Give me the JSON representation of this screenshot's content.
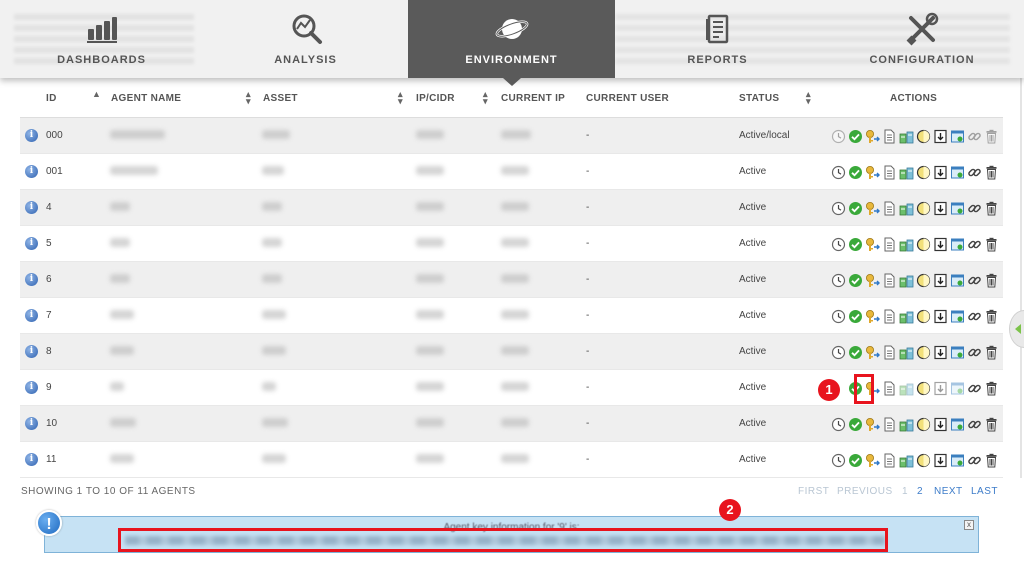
{
  "nav": {
    "tabs": [
      {
        "label": "DASHBOARDS",
        "icon": "bar-chart-icon"
      },
      {
        "label": "ANALYSIS",
        "icon": "magnify-chart-icon"
      },
      {
        "label": "ENVIRONMENT",
        "icon": "planet-icon",
        "active": true
      },
      {
        "label": "REPORTS",
        "icon": "document-icon"
      },
      {
        "label": "CONFIGURATION",
        "icon": "tools-icon"
      }
    ]
  },
  "table": {
    "headers": [
      "ID",
      "AGENT NAME",
      "ASSET",
      "IP/CIDR",
      "CURRENT IP",
      "CURRENT USER",
      "STATUS",
      "ACTIONS"
    ],
    "rows": [
      {
        "id": "000",
        "user": "-",
        "status": "Active/local"
      },
      {
        "id": "001",
        "user": "-",
        "status": "Active"
      },
      {
        "id": "4",
        "user": "-",
        "status": "Active"
      },
      {
        "id": "5",
        "user": "-",
        "status": "Active"
      },
      {
        "id": "6",
        "user": "-",
        "status": "Active"
      },
      {
        "id": "7",
        "user": "-",
        "status": "Active"
      },
      {
        "id": "8",
        "user": "-",
        "status": "Active"
      },
      {
        "id": "9",
        "user": "-",
        "status": "Active"
      },
      {
        "id": "10",
        "user": "-",
        "status": "Active"
      },
      {
        "id": "11",
        "user": "-",
        "status": "Active"
      }
    ]
  },
  "footer": {
    "showing": "SHOWING 1 TO 10 OF 11 AGENTS",
    "first": "FIRST",
    "previous": "PREVIOUS",
    "page1": "1",
    "page2": "2",
    "next": "NEXT",
    "last": "LAST"
  },
  "notice": {
    "title": "Agent key information for '9' is:",
    "close": "x"
  },
  "annotations": {
    "badge1": "1",
    "badge2": "2"
  },
  "colors": {
    "accent": "#5a5a5a",
    "annotation_red": "#e8141e",
    "notice_bg": "#c6e2f4",
    "link_blue": "#3d7cc9"
  }
}
